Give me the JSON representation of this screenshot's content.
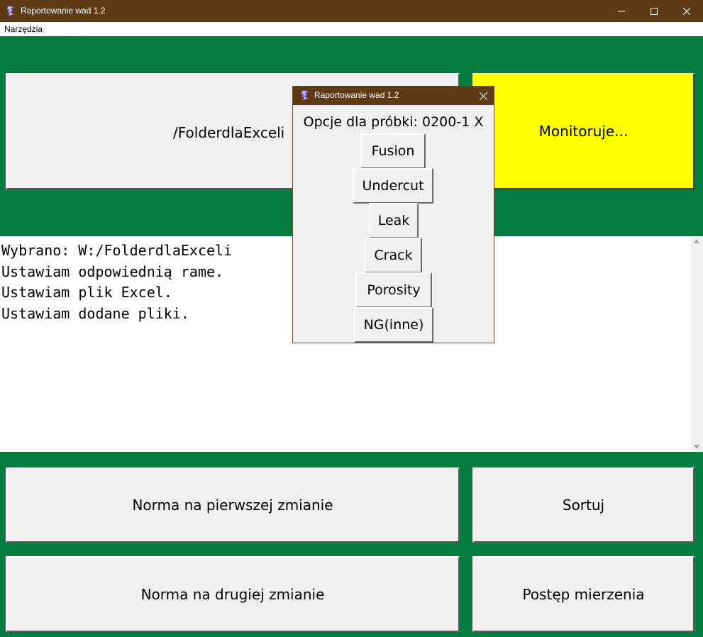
{
  "window": {
    "title": "Raportowanie wad 1.2",
    "controls": [
      "minimize-icon",
      "maximize-icon",
      "close-icon"
    ]
  },
  "menubar": {
    "items": [
      "Narzędzia"
    ]
  },
  "top_buttons": {
    "folder_label": "/FolderdlaExceli",
    "monitor_label": "Monitoruje...",
    "monitor_color": "#ffff00"
  },
  "log": {
    "lines": [
      "Wybrano: W:/FolderdlaExceli",
      "Ustawiam odpowiednią rame.",
      "Ustawiam plik Excel.",
      "Ustawiam dodane pliki."
    ]
  },
  "bottom_buttons": {
    "norm_first": "Norma na pierwszej zmianie",
    "sort": "Sortuj",
    "norm_second": "Norma na drugiej zmianie",
    "progress": "Postęp mierzenia"
  },
  "popup": {
    "title": "Raportowanie wad 1.2",
    "heading": "Opcje dla próbki: 0200-1 X",
    "options": [
      "Fusion",
      "Undercut",
      "Leak",
      "Crack",
      "Porosity",
      "NG(inne)"
    ]
  },
  "colors": {
    "titlebar": "#5e3a17",
    "background": "#047b3f",
    "button": "#f0f0f0"
  }
}
